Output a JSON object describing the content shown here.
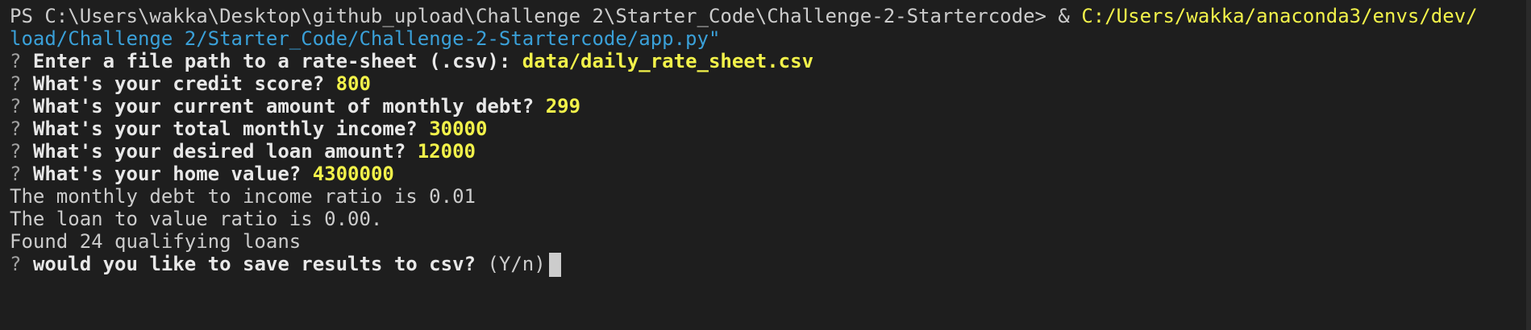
{
  "terminal": {
    "line1": {
      "prompt": "PS C:\\Users\\wakka\\Desktop\\github_upload\\Challenge 2\\Starter_Code\\Challenge-2-Startercode> & ",
      "command": "C:/Users/wakka/anaconda3/envs/dev/"
    },
    "line2": {
      "text": "load/Challenge 2/Starter_Code/Challenge-2-Startercode/app.py\""
    },
    "questions": [
      {
        "mark": "?",
        "question": "Enter a file path to a rate-sheet (.csv):",
        "answer": "data/daily_rate_sheet.csv"
      },
      {
        "mark": "?",
        "question": "What's your credit score?",
        "answer": "800"
      },
      {
        "mark": "?",
        "question": "What's your current amount of monthly debt?",
        "answer": "299"
      },
      {
        "mark": "?",
        "question": "What's your total monthly income?",
        "answer": "30000"
      },
      {
        "mark": "?",
        "question": "What's your desired loan amount?",
        "answer": "12000"
      },
      {
        "mark": "?",
        "question": "What's your home value?",
        "answer": "4300000"
      }
    ],
    "outputs": [
      "The monthly debt to income ratio is 0.01",
      "The loan to value ratio is 0.00.",
      "Found 24 qualifying loans"
    ],
    "final_prompt": {
      "mark": "?",
      "question": "would you like to save results to csv?",
      "hint": "(Y/n)"
    }
  }
}
